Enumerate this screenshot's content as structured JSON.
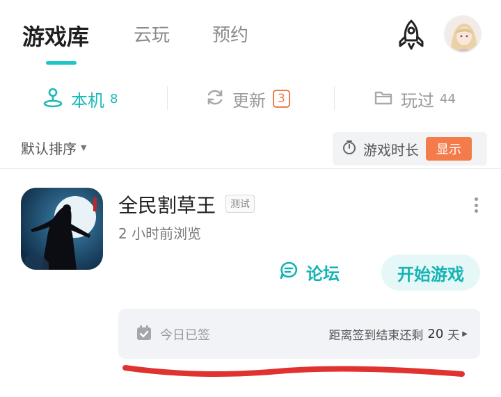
{
  "top_tabs": {
    "library": "游戏库",
    "cloud": "云玩",
    "reserve": "预约"
  },
  "sub_tabs": {
    "local": {
      "label": "本机",
      "count": "8"
    },
    "update": {
      "label": "更新",
      "count": "3"
    },
    "played": {
      "label": "玩过",
      "count": "44"
    }
  },
  "sort": {
    "label": "默认排序",
    "duration_label": "游戏时长",
    "show_button": "显示"
  },
  "game": {
    "title": "全民割草王",
    "badge": "测试",
    "subtitle": "2 小时前浏览",
    "forum_label": "论坛",
    "start_label": "开始游戏"
  },
  "signin": {
    "status": "今日已签",
    "remaining_prefix": "距离签到结束还剩",
    "remaining_days": "20",
    "remaining_unit": "天"
  },
  "colors": {
    "accent": "#1ab8b8",
    "orange": "#f47b4a",
    "scribble": "#e0322f"
  },
  "icons": [
    "rocket-icon",
    "pin-location-icon",
    "refresh-icon",
    "folder-icon",
    "timer-icon",
    "chat-forum-icon",
    "calendar-check-icon",
    "more-vertical-icon"
  ]
}
